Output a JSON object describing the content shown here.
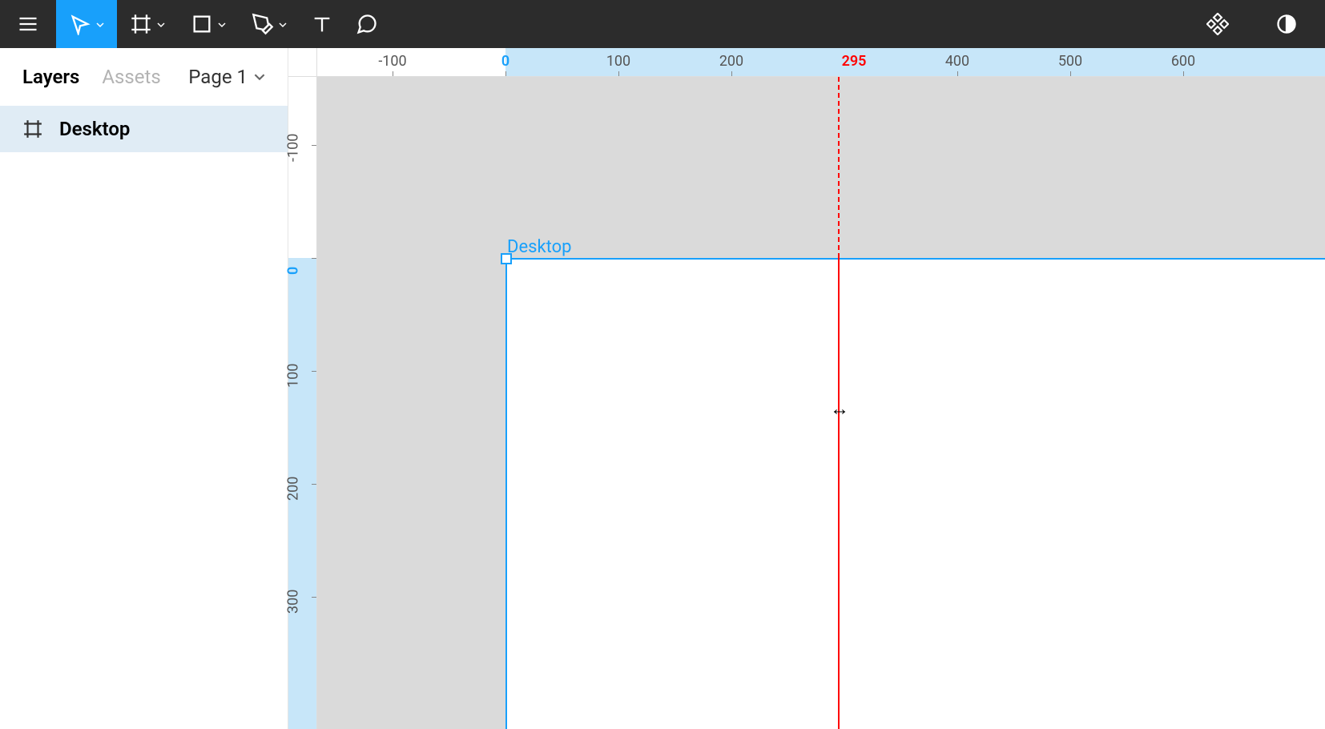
{
  "sidebar": {
    "tabs": {
      "layers": "Layers",
      "assets": "Assets"
    },
    "page_selector": "Page 1",
    "layer": {
      "name": "Desktop"
    }
  },
  "ruler": {
    "horizontal": [
      "-100",
      "0",
      "100",
      "200",
      "295",
      "400",
      "500",
      "600"
    ],
    "vertical": [
      "-100",
      "0",
      "100",
      "200",
      "300"
    ],
    "guide_position": "295"
  },
  "canvas": {
    "frame_label": "Desktop"
  },
  "colors": {
    "accent": "#18a0fb",
    "guide": "#ff0000",
    "toolbar": "#2c2c2c"
  }
}
